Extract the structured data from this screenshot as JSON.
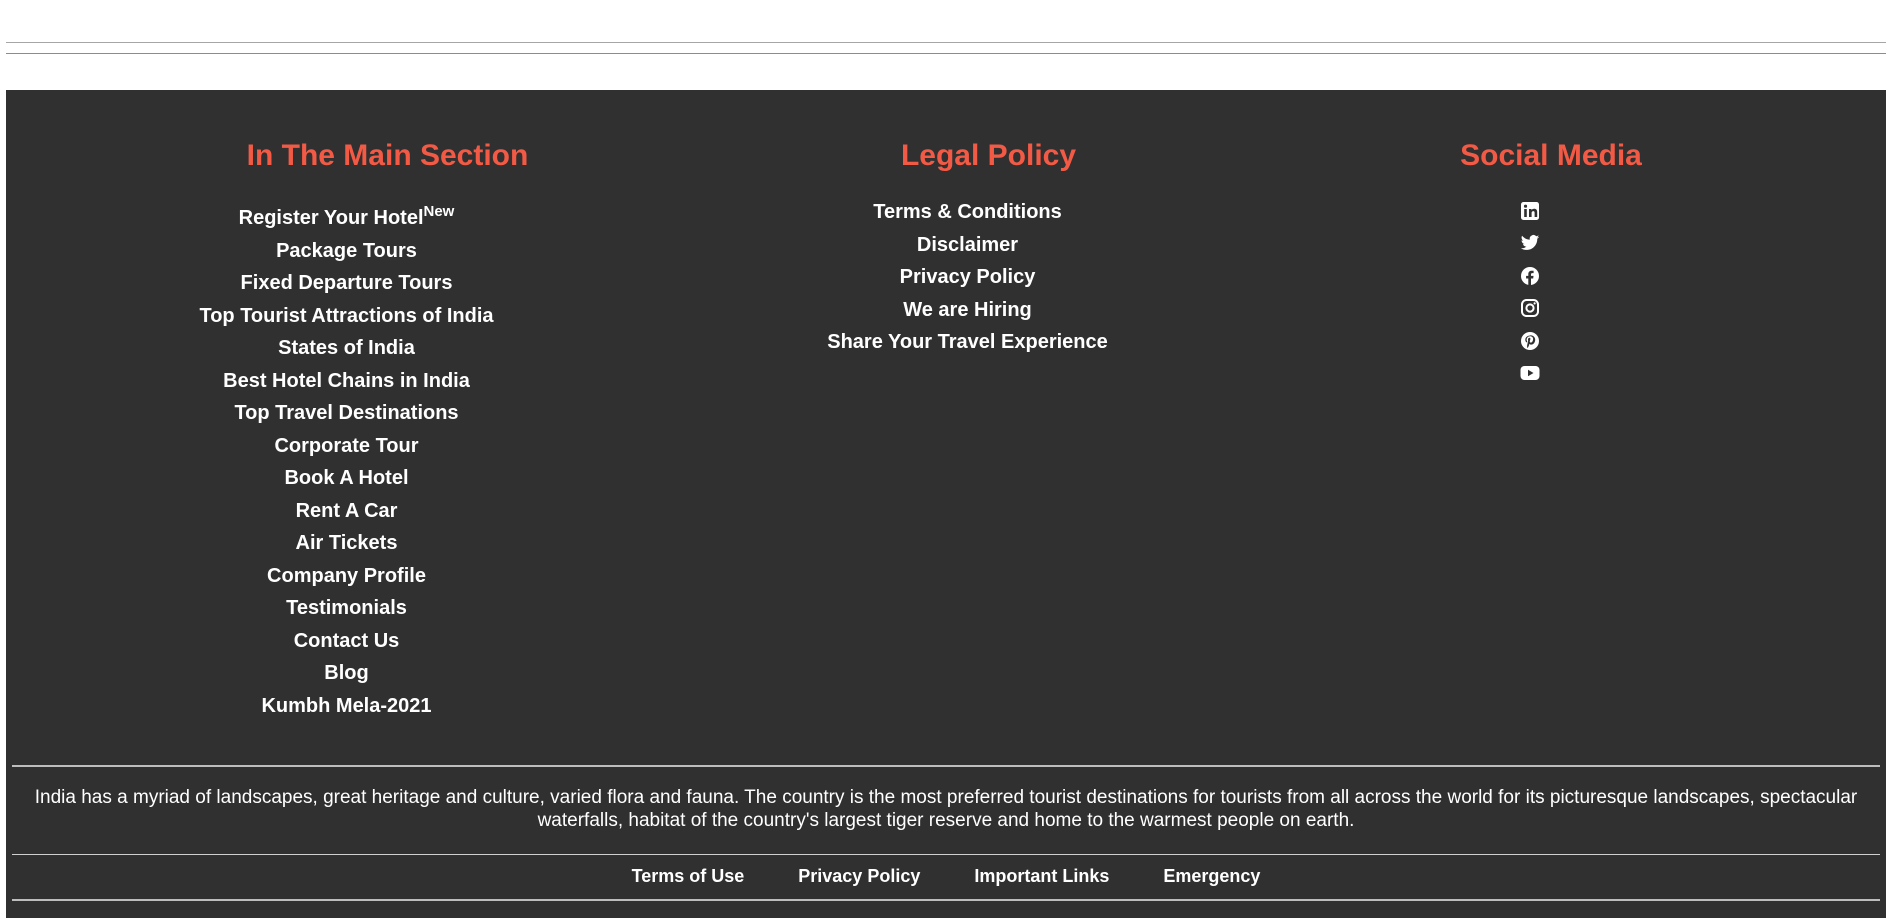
{
  "main_section": {
    "heading": "In The Main Section",
    "items": [
      {
        "label": "Register Your Hotel",
        "badge": "New"
      },
      {
        "label": "Package Tours"
      },
      {
        "label": "Fixed Departure Tours"
      },
      {
        "label": "Top Tourist Attractions of India"
      },
      {
        "label": "States of India"
      },
      {
        "label": "Best Hotel Chains in India"
      },
      {
        "label": "Top Travel Destinations"
      },
      {
        "label": "Corporate Tour"
      },
      {
        "label": "Book A Hotel"
      },
      {
        "label": "Rent A Car"
      },
      {
        "label": "Air Tickets"
      },
      {
        "label": "Company Profile"
      },
      {
        "label": "Testimonials"
      },
      {
        "label": "Contact Us"
      },
      {
        "label": "Blog"
      },
      {
        "label": "Kumbh Mela-2021"
      }
    ]
  },
  "legal_policy": {
    "heading": "Legal Policy",
    "items": [
      {
        "label": "Terms & Conditions"
      },
      {
        "label": "Disclaimer"
      },
      {
        "label": "Privacy Policy"
      },
      {
        "label": "We are Hiring"
      },
      {
        "label": "Share Your Travel Experience"
      }
    ]
  },
  "social_media": {
    "heading": "Social Media",
    "icons": [
      "linkedin-icon",
      "twitter-icon",
      "facebook-icon",
      "instagram-icon",
      "pinterest-icon",
      "youtube-icon"
    ]
  },
  "about_text": "India has a myriad of landscapes, great heritage and culture, varied flora and fauna. The country is the most preferred tourist destinations for tourists from all across the world for its picturesque landscapes, spectacular waterfalls, habitat of the country's largest tiger reserve and home to the warmest people on earth.",
  "bottom_nav": {
    "items": [
      {
        "label": "Terms of Use"
      },
      {
        "label": "Privacy Policy"
      },
      {
        "label": "Important Links"
      },
      {
        "label": "Emergency"
      }
    ]
  },
  "colors": {
    "footer_background": "#303030",
    "heading_accent": "#f25a45",
    "text": "#ffffff"
  }
}
